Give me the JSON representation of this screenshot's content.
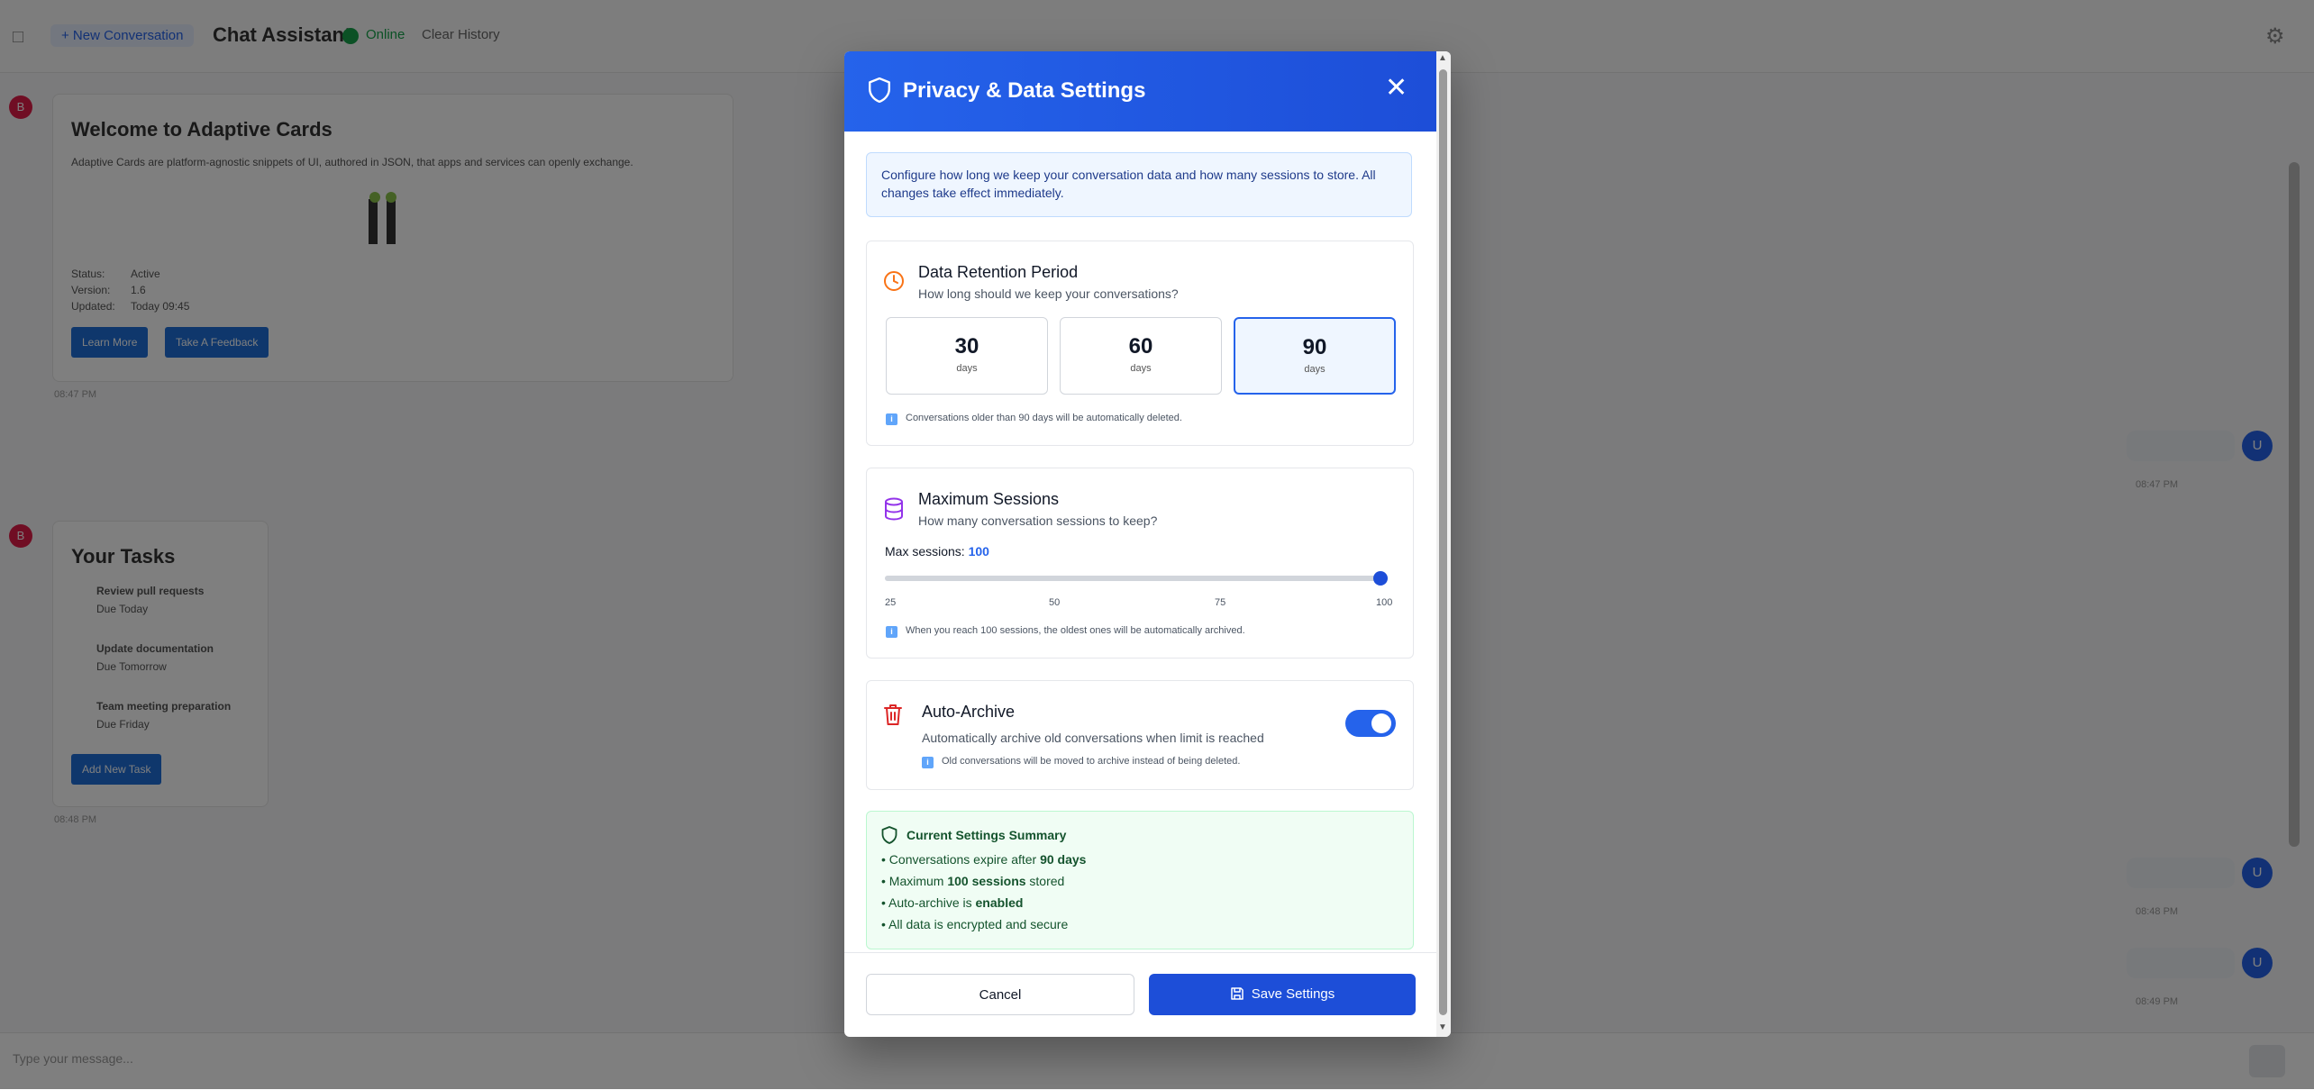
{
  "background": {
    "new_conversation": "+ New Conversation",
    "app_title": "Chat Assistant",
    "status": "Online",
    "clear_history": "Clear History",
    "card1": {
      "title": "Welcome to Adaptive Cards",
      "body": "Adaptive Cards are platform-agnostic snippets of UI, authored in JSON, that apps and services can openly exchange.",
      "facts": [
        {
          "k": "Status:",
          "v": "Active"
        },
        {
          "k": "Version:",
          "v": "1.6"
        },
        {
          "k": "Updated:",
          "v": "Today 09:45"
        }
      ],
      "buttons": [
        "Learn More",
        "Take A Feedback"
      ],
      "time": "08:47 PM"
    },
    "card2": {
      "title": "Your Tasks",
      "tasks": [
        {
          "name": "Review pull requests",
          "due": "Due Today"
        },
        {
          "name": "Update documentation",
          "due": "Due Tomorrow"
        },
        {
          "name": "Team meeting preparation",
          "due": "Due Friday"
        }
      ],
      "button": "Add New Task",
      "time": "08:48 PM"
    },
    "user_times": [
      "08:47 PM",
      "08:48 PM",
      "08:49 PM"
    ],
    "input_placeholder": "Type your message..."
  },
  "modal": {
    "title": "Privacy & Data Settings",
    "close_icon": "close-icon",
    "intro": "Configure how long we keep your conversation data and how many sessions to store. All changes take effect immediately.",
    "retention": {
      "title": "Data Retention Period",
      "subtitle": "How long should we keep your conversations?",
      "options": [
        {
          "value": "30",
          "unit": "days"
        },
        {
          "value": "60",
          "unit": "days"
        },
        {
          "value": "90",
          "unit": "days"
        }
      ],
      "selected": "90",
      "note": "Conversations older than 90 days will be automatically deleted.",
      "accent": "#f97316"
    },
    "sessions": {
      "title": "Maximum Sessions",
      "subtitle": "How many conversation sessions to keep?",
      "label": "Max sessions:",
      "value": "100",
      "min": 25,
      "max": 100,
      "current": 100,
      "ticks": [
        "25",
        "50",
        "75",
        "100"
      ],
      "note": "When you reach 100 sessions, the oldest ones will be automatically archived.",
      "accent": "#9333ea"
    },
    "auto_archive": {
      "title": "Auto-Archive",
      "subtitle": "Automatically archive old conversations when limit is reached",
      "note": "Old conversations will be moved to archive instead of being deleted.",
      "enabled": true,
      "accent": "#dc2626"
    },
    "summary": {
      "title": "Current Settings Summary",
      "line1_pre": "• Conversations expire after ",
      "line1_bold": "90 days",
      "line2_pre": "• Maximum ",
      "line2_bold": "100 sessions",
      "line2_post": " stored",
      "line3_pre": "• Auto-archive is ",
      "line3_bold": "enabled",
      "line4": "• All data is encrypted and secure"
    },
    "buttons": {
      "cancel": "Cancel",
      "save": "Save Settings"
    },
    "colors": {
      "primary": "#2563eb",
      "success_bg": "#f0fdf4"
    }
  }
}
